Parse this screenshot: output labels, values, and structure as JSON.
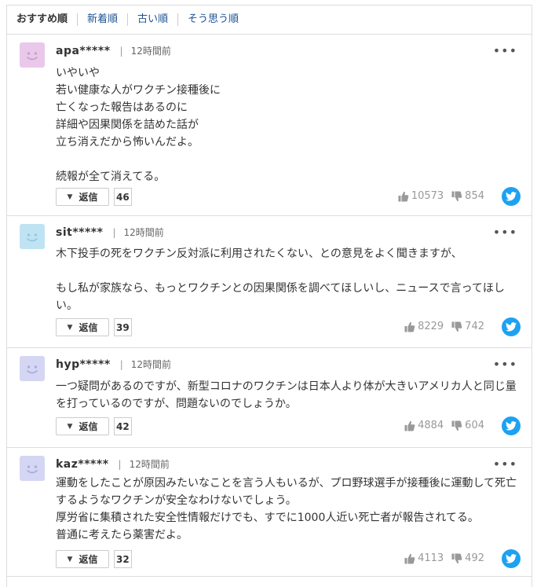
{
  "sort_tabs": [
    "おすすめ順",
    "新着順",
    "古い順",
    "そう思う順"
  ],
  "colors": {
    "link": "#1d5295",
    "twitter": "#1da1f2"
  },
  "comments": [
    {
      "user": "apa*****",
      "time": "12時間前",
      "avatar_color": "#e9c8ea",
      "avatar_face": "#c99ccb",
      "body": "いやいや\n若い健康な人がワクチン接種後に\n亡くなった報告はあるのに\n詳細や因果関係を詰めた話が\n立ち消えだから怖いんだよ。\n\n続報が全て消えてる。",
      "reply_label": "返信",
      "reply_count": "46",
      "likes": "10573",
      "dislikes": "854"
    },
    {
      "user": "sit*****",
      "time": "12時間前",
      "avatar_color": "#bfe3f3",
      "avatar_face": "#8fc8df",
      "body": "木下投手の死をワクチン反対派に利用されたくない、との意見をよく聞きますが、\n\nもし私が家族なら、もっとワクチンとの因果関係を調べてほしいし、ニュースで言ってほしい。",
      "reply_label": "返信",
      "reply_count": "39",
      "likes": "8229",
      "dislikes": "742"
    },
    {
      "user": "hyp*****",
      "time": "12時間前",
      "avatar_color": "#d4d6f3",
      "avatar_face": "#a6aadf",
      "body": "一つ疑問があるのですが、新型コロナのワクチンは日本人より体が大きいアメリカ人と同じ量を打っているのですが、問題ないのでしょうか。",
      "reply_label": "返信",
      "reply_count": "42",
      "likes": "4884",
      "dislikes": "604"
    },
    {
      "user": "kaz*****",
      "time": "12時間前",
      "avatar_color": "#d4d6f3",
      "avatar_face": "#a6aadf",
      "body": "運動をしたことが原因みたいなことを言う人もいるが、プロ野球選手が接種後に運動して死亡するようなワクチンが安全なわけないでしょう。\n厚労省に集積された安全性情報だけでも、すでに1000人近い死亡者が報告されてる。\n普通に考えたら薬害だよ。",
      "reply_label": "返信",
      "reply_count": "32",
      "likes": "4113",
      "dislikes": "492"
    }
  ]
}
